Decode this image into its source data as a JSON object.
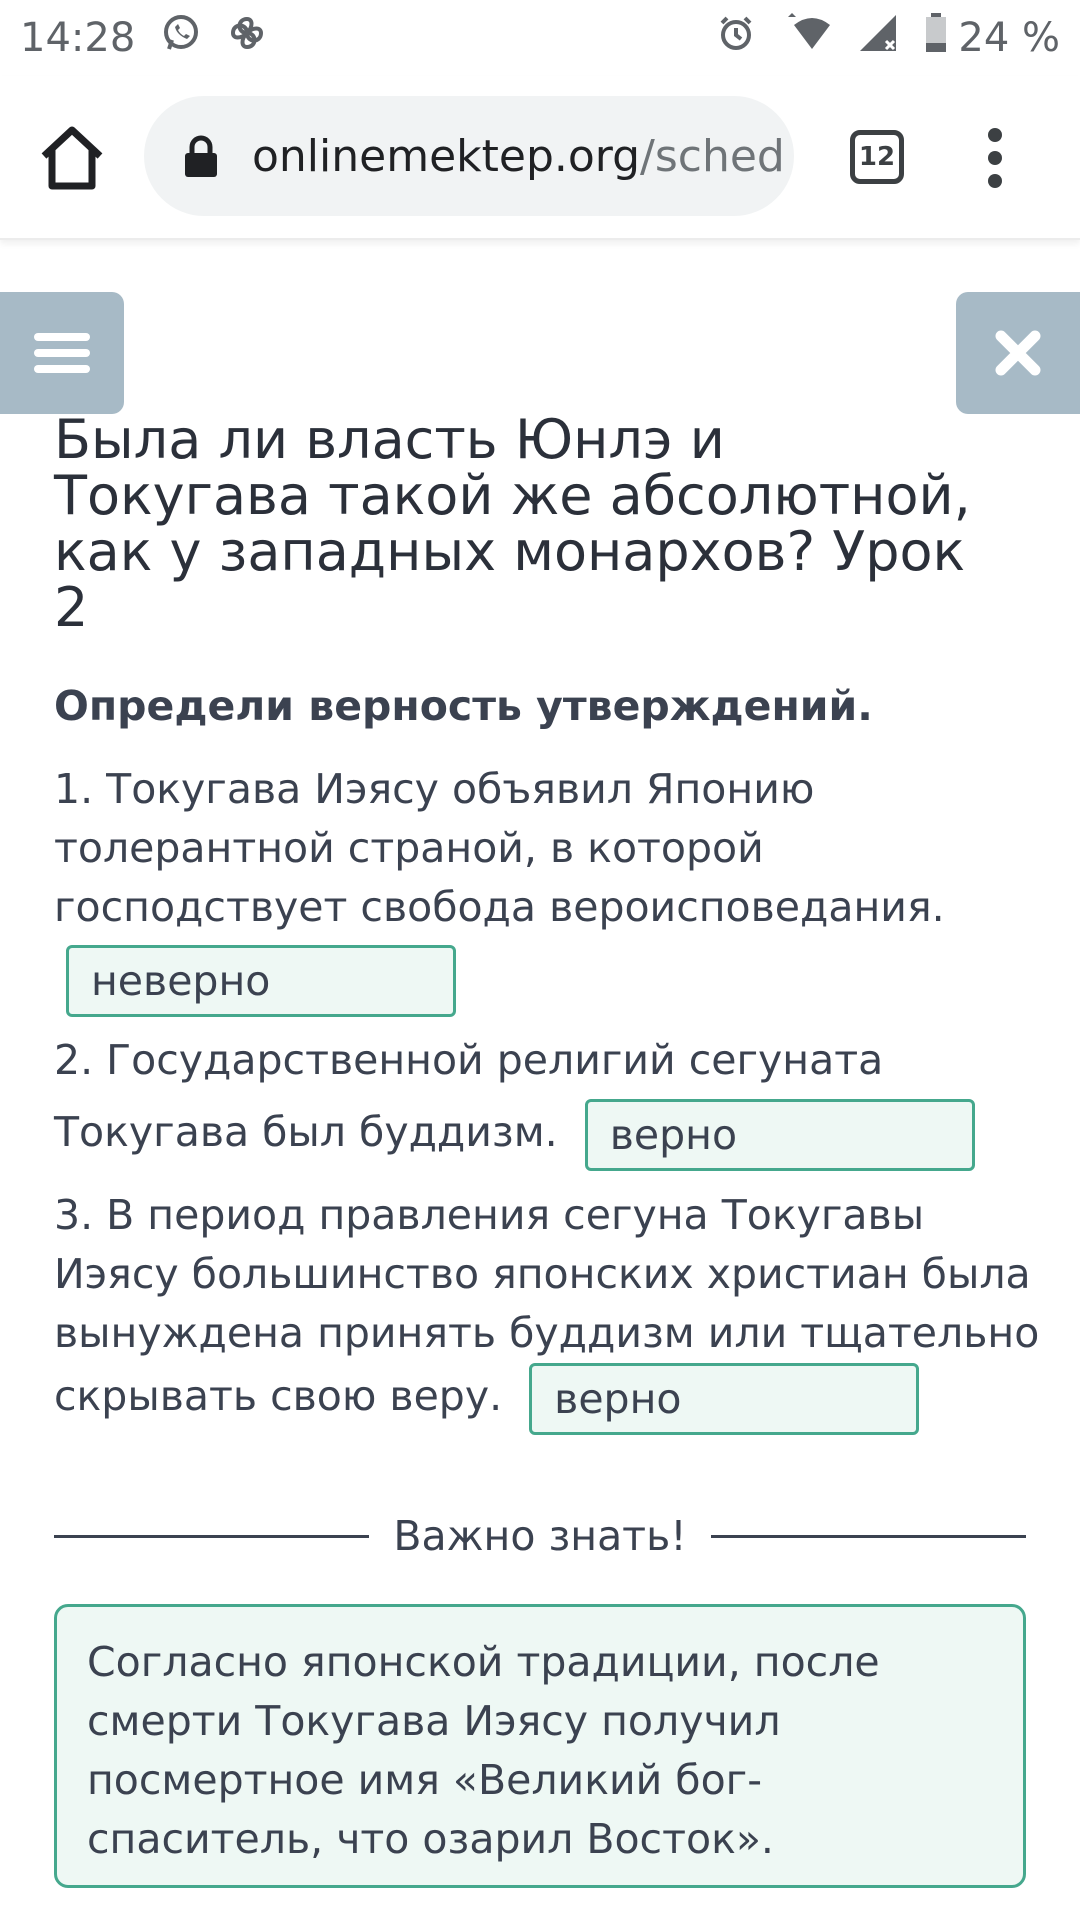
{
  "status_bar": {
    "time": "14:28",
    "battery": "24 %",
    "icons": [
      "whatsapp-icon",
      "pinwheel-icon",
      "alarm-icon",
      "wifi-icon",
      "signal-icon",
      "battery-icon"
    ]
  },
  "browser": {
    "url_domain": "onlinemektep.org",
    "url_path": "/sched",
    "tab_count": "12"
  },
  "lesson": {
    "title": "Была ли власть Юнлэ и Токугава такой же абсолютной, как у западных монархов? Урок 2",
    "instruction": "Определи верность утверждений.",
    "questions": [
      {
        "text": "1. Токугава Иэясу объявил Японию толерантной страной, в которой господствует свобода вероисповедания.",
        "answer": "неверно"
      },
      {
        "text": "2. Государственной религий сегуната Токугава был буддизм.",
        "answer": "верно"
      },
      {
        "text": "3. В период правления сегуна Токугавы Иэясу большинство японских христиан была вынуждена принять буддизм или тщательно скрывать свою веру.",
        "answer": "верно"
      }
    ],
    "divider_label": "Важно знать!",
    "info_text": "Согласно японской традиции, после смерти Токугава Иэясу получил посмертное имя «Великий бог-спаситель, что озарил Восток»."
  },
  "colors": {
    "accent_green": "#45a88d",
    "answer_bg": "#eef8f4",
    "side_button": "#a7bac6"
  }
}
